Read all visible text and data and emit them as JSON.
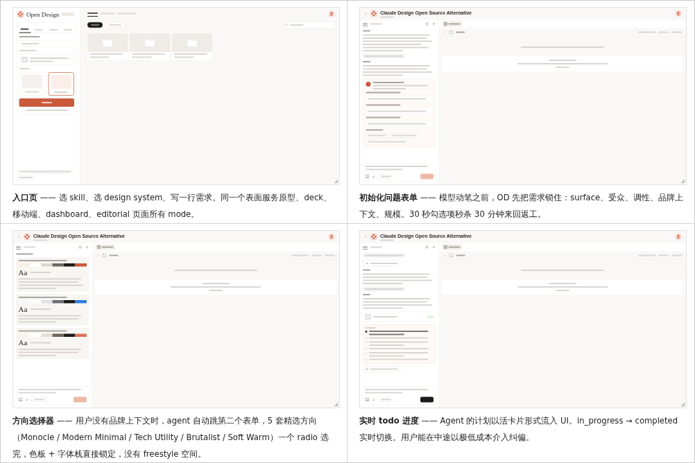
{
  "panels": [
    {
      "caption": "**入口页** —— 选 skill、选 design system、写一行需求。同一个表面服务原型、deck、移动端、dashboard、editorial 页面所有 mode。",
      "screen": {
        "kind": "home",
        "brand": "Open Design",
        "mode_tabs": [
          {
            "selected": true
          },
          {
            "selected": false
          },
          {
            "selected": false
          },
          {
            "selected": false
          }
        ],
        "fidelity": [
          {
            "selected": false
          },
          {
            "selected": true
          }
        ],
        "main_tabs": [
          {
            "selected": true
          },
          {
            "selected": false
          },
          {
            "selected": false
          }
        ],
        "filters": [
          {
            "selected": true
          },
          {
            "selected": false
          }
        ],
        "cards": [
          {
            "kind": "project"
          },
          {
            "kind": "project"
          },
          {
            "kind": "project"
          }
        ]
      }
    },
    {
      "caption": "**初始化问题表单** —— 模型动笔之前，OD 先把需求锁住：surface、受众、调性、品牌上下文、规模。30 秒勾选项秒杀 30 分钟来回返工。",
      "screen": {
        "kind": "chat",
        "title": "Claude Design Open Source Alternative",
        "blocks": [
          {
            "kind": "text"
          },
          {
            "kind": "chip"
          },
          {
            "kind": "text"
          },
          {
            "kind": "brief"
          }
        ],
        "send": {
          "kind": "send"
        }
      }
    },
    {
      "caption": "**方向选择器** —— 用户没有品牌上下文时，agent 自动跳第二个表单，5 套精选方向（Monocle / Modern Minimal / Tech Utility / Brutalist / Soft Warm）一个 radio 选完，色板 + 字体栈直接锁定，没有 freestyle 空间。",
      "screen": {
        "kind": "chat",
        "title": "Claude Design Open Source Alternative",
        "blocks": [
          {
            "kind": "label"
          },
          {
            "kind": "direction",
            "sample": "Aa"
          },
          {
            "kind": "direction",
            "sample": "Aa"
          },
          {
            "kind": "direction",
            "sample": "Aa"
          }
        ],
        "send": {
          "kind": "send"
        }
      }
    },
    {
      "caption": "**实时 todo 进度** —— Agent 的计划以活卡片形式流入 UI。in_progress → completed 实时切换。用户能在中途以极低成本介入纠偏。",
      "screen": {
        "kind": "chat",
        "title": "Claude Design Open Source Alternative",
        "blocks": [
          {
            "kind": "chip"
          },
          {
            "kind": "status"
          },
          {
            "kind": "text"
          },
          {
            "kind": "chip"
          },
          {
            "kind": "text"
          },
          {
            "kind": "tool"
          },
          {
            "kind": "todos",
            "items": [
              {
                "active": true
              },
              {
                "active": false
              },
              {
                "active": false
              },
              {
                "active": false
              },
              {
                "active": false
              },
              {
                "active": false
              }
            ]
          },
          {
            "kind": "status"
          }
        ],
        "send": {
          "kind": "stop"
        }
      }
    }
  ]
}
